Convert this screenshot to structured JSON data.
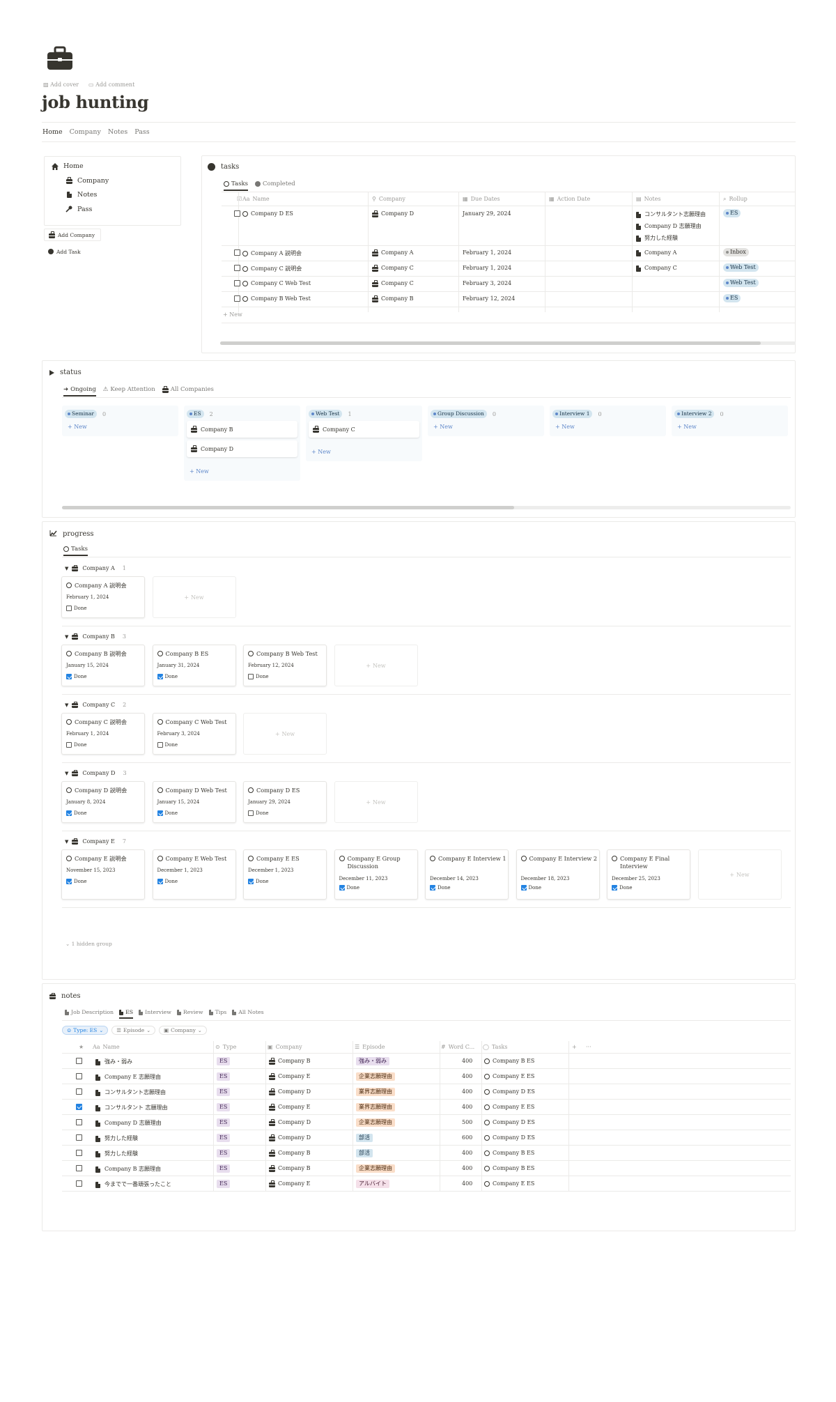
{
  "page": {
    "title": "job hunting",
    "add_cover": "Add cover",
    "add_comment": "Add comment",
    "icon": "briefcase-icon"
  },
  "top_nav": [
    "Home",
    "Company",
    "Notes",
    "Pass"
  ],
  "sidebar": {
    "items": [
      {
        "label": "Home",
        "icon": "home-icon"
      },
      {
        "label": "Company",
        "icon": "briefcase-icon"
      },
      {
        "label": "Notes",
        "icon": "page-icon"
      },
      {
        "label": "Pass",
        "icon": "key-icon"
      }
    ],
    "buttons": [
      "Add Company",
      "Add Task"
    ]
  },
  "tasks": {
    "title": "tasks",
    "tabs": [
      "Tasks",
      "Completed"
    ],
    "columns": [
      "Name",
      "Company",
      "Due Dates",
      "Action Date",
      "Notes",
      "Rollup"
    ],
    "rows": [
      {
        "name": "Company D ES",
        "company": "Company D",
        "due": "January 29, 2024",
        "notes": [
          "コンサルタント志願理由",
          "Company D 志願理由",
          "努力した経験"
        ],
        "rollup": "ES",
        "rollup_color": "blue"
      },
      {
        "name": "Company A 説明会",
        "company": "Company A",
        "due": "February 1, 2024",
        "notes": [
          "Company A"
        ],
        "rollup": "Inbox",
        "rollup_color": "gray"
      },
      {
        "name": "Company C 説明会",
        "company": "Company C",
        "due": "February 1, 2024",
        "notes": [
          "Company C"
        ],
        "rollup": "Web Test",
        "rollup_color": "blue"
      },
      {
        "name": "Company C Web Test",
        "company": "Company C",
        "due": "February 3, 2024",
        "notes": [],
        "rollup": "Web Test",
        "rollup_color": "blue"
      },
      {
        "name": "Company B Web Test",
        "company": "Company B",
        "due": "February 12, 2024",
        "notes": [],
        "rollup": "ES",
        "rollup_color": "blue"
      }
    ],
    "new_label": "New"
  },
  "status": {
    "title": "status",
    "tabs": [
      "Ongoing",
      "Keep Attention",
      "All Companies"
    ],
    "columns": [
      {
        "label": "Seminar",
        "count": "0",
        "cards": []
      },
      {
        "label": "ES",
        "count": "2",
        "cards": [
          "Company B",
          "Company D"
        ]
      },
      {
        "label": "Web Test",
        "count": "1",
        "cards": [
          "Company C"
        ]
      },
      {
        "label": "Group Discussion",
        "count": "0",
        "cards": []
      },
      {
        "label": "Interview 1",
        "count": "0",
        "cards": []
      },
      {
        "label": "Interview 2",
        "count": "0",
        "cards": []
      }
    ],
    "new_label": "New"
  },
  "progress": {
    "title": "progress",
    "tabs": [
      "Tasks"
    ],
    "done_label": "Done",
    "new_label": "New",
    "hidden_group": "1 hidden group",
    "groups": [
      {
        "company": "Company A",
        "count": "1",
        "cards": [
          {
            "title": "Company A 説明会",
            "date": "February 1, 2024",
            "done": false
          }
        ]
      },
      {
        "company": "Company B",
        "count": "3",
        "cards": [
          {
            "title": "Company B 説明会",
            "date": "January 15, 2024",
            "done": true
          },
          {
            "title": "Company B ES",
            "date": "January 31, 2024",
            "done": true
          },
          {
            "title": "Company B Web Test",
            "date": "February 12, 2024",
            "done": false
          }
        ]
      },
      {
        "company": "Company C",
        "count": "2",
        "cards": [
          {
            "title": "Company C 説明会",
            "date": "February 1, 2024",
            "done": false
          },
          {
            "title": "Company C Web Test",
            "date": "February 3, 2024",
            "done": false
          }
        ]
      },
      {
        "company": "Company D",
        "count": "3",
        "cards": [
          {
            "title": "Company D 説明会",
            "date": "January 8, 2024",
            "done": true
          },
          {
            "title": "Company D Web Test",
            "date": "January 15, 2024",
            "done": true
          },
          {
            "title": "Company D ES",
            "date": "January 29, 2024",
            "done": false
          }
        ]
      },
      {
        "company": "Company E",
        "count": "7",
        "cards": [
          {
            "title": "Company E 説明会",
            "date": "November 15, 2023",
            "done": true
          },
          {
            "title": "Company E Web Test",
            "date": "December 1, 2023",
            "done": true
          },
          {
            "title": "Company E ES",
            "date": "December 1, 2023",
            "done": true
          },
          {
            "title": "Company E Group Discussion",
            "date": "December 11, 2023",
            "done": true
          },
          {
            "title": "Company E Interview 1",
            "date": "December 14, 2023",
            "done": true
          },
          {
            "title": "Company E Interview 2",
            "date": "December 18, 2023",
            "done": true
          },
          {
            "title": "Company E Final Interview",
            "date": "December 25, 2023",
            "done": true
          }
        ]
      }
    ]
  },
  "notes": {
    "title": "notes",
    "tabs": [
      "Job Description",
      "ES",
      "Interview",
      "Review",
      "Tips",
      "All Notes"
    ],
    "filters": [
      "Type: ES",
      "Episode",
      "Company"
    ],
    "columns": [
      "Name",
      "Type",
      "Company",
      "Episode",
      "Word C...",
      "Tasks"
    ],
    "rows": [
      {
        "checked": false,
        "name": "強み・弱み",
        "type": "ES",
        "company": "Company B",
        "episode": "強み・弱み",
        "episode_color": "purple",
        "words": "400",
        "task": "Company B ES"
      },
      {
        "checked": false,
        "name": "Company E 志願理由",
        "type": "ES",
        "company": "Company E",
        "episode": "企業志願理由",
        "episode_color": "orange",
        "words": "400",
        "task": "Company E ES"
      },
      {
        "checked": false,
        "name": "コンサルタント志願理由",
        "type": "ES",
        "company": "Company D",
        "episode": "業界志願理由",
        "episode_color": "orange",
        "words": "400",
        "task": "Company D ES"
      },
      {
        "checked": true,
        "name": "コンサルタント 志願理由",
        "type": "ES",
        "company": "Company E",
        "episode": "業界志願理由",
        "episode_color": "orange",
        "words": "400",
        "task": "Company E ES"
      },
      {
        "checked": false,
        "name": "Company D 志願理由",
        "type": "ES",
        "company": "Company D",
        "episode": "企業志願理由",
        "episode_color": "orange",
        "words": "500",
        "task": "Company D ES"
      },
      {
        "checked": false,
        "name": "努力した経験",
        "type": "ES",
        "company": "Company D",
        "episode": "部活",
        "episode_color": "blue",
        "words": "600",
        "task": "Company D ES"
      },
      {
        "checked": false,
        "name": "努力した経験",
        "type": "ES",
        "company": "Company B",
        "episode": "部活",
        "episode_color": "blue",
        "words": "400",
        "task": "Company B ES"
      },
      {
        "checked": false,
        "name": "Company B 志願理由",
        "type": "ES",
        "company": "Company B",
        "episode": "企業志願理由",
        "episode_color": "orange",
        "words": "400",
        "task": "Company B ES"
      },
      {
        "checked": false,
        "name": "今までで一番頑張ったこと",
        "type": "ES",
        "company": "Company E",
        "episode": "アルバイト",
        "episode_color": "pink",
        "words": "400",
        "task": "Company E ES"
      }
    ]
  }
}
